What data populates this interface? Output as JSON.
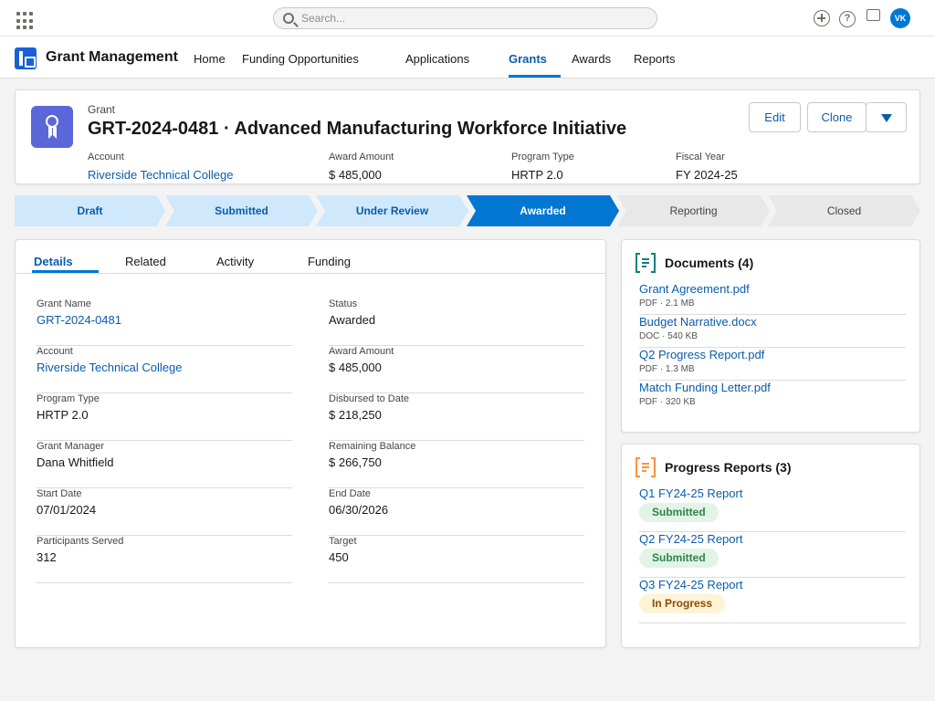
{
  "header": {
    "search_placeholder": "Search...",
    "avatar_initials": "VK"
  },
  "nav": {
    "app_name": "Grant Management",
    "items": [
      {
        "label": "Home"
      },
      {
        "label": "Funding Opportunities"
      },
      {
        "label": "Applications"
      },
      {
        "label": "Grants",
        "active": true
      },
      {
        "label": "Awards"
      },
      {
        "label": "Reports"
      }
    ]
  },
  "record": {
    "object_label": "Grant",
    "title": "GRT-2024-0481 · Advanced Manufacturing Workforce Initiative",
    "buttons": {
      "edit": "Edit",
      "clone": "Clone"
    },
    "highlights": [
      {
        "label": "Account",
        "value": "Riverside Technical College",
        "link": true
      },
      {
        "label": "Award Amount",
        "value": "$ 485,000"
      },
      {
        "label": "Program Type",
        "value": "HRTP 2.0"
      },
      {
        "label": "Fiscal Year",
        "value": "FY 2024-25"
      }
    ]
  },
  "path": {
    "stages": [
      {
        "label": "Draft",
        "state": "done"
      },
      {
        "label": "Submitted",
        "state": "done"
      },
      {
        "label": "Under Review",
        "state": "done"
      },
      {
        "label": "Awarded",
        "state": "current"
      },
      {
        "label": "Reporting",
        "state": "todo"
      },
      {
        "label": "Closed",
        "state": "todo"
      }
    ]
  },
  "details": {
    "tabs": [
      {
        "label": "Details",
        "active": true
      },
      {
        "label": "Related"
      },
      {
        "label": "Activity"
      },
      {
        "label": "Funding"
      }
    ],
    "fields": [
      {
        "label": "Grant Name",
        "value": "GRT-2024-0481",
        "link": true
      },
      {
        "label": "Status",
        "value": "Awarded"
      },
      {
        "label": "Account",
        "value": "Riverside Technical College",
        "link": true
      },
      {
        "label": "Award Amount",
        "value": "$ 485,000"
      },
      {
        "label": "Program Type",
        "value": "HRTP 2.0"
      },
      {
        "label": "Disbursed to Date",
        "value": "$ 218,250"
      },
      {
        "label": "Grant Manager",
        "value": "Dana Whitfield"
      },
      {
        "label": "Remaining Balance",
        "value": "$ 266,750"
      },
      {
        "label": "Start Date",
        "value": "07/01/2024"
      },
      {
        "label": "End Date",
        "value": "06/30/2026"
      },
      {
        "label": "Participants Served",
        "value": "312"
      },
      {
        "label": "Target",
        "value": "450"
      }
    ]
  },
  "documents": {
    "title": "Documents (4)",
    "icon_color": "#0b827c",
    "items": [
      {
        "name": "Grant Agreement.pdf",
        "meta": "PDF · 2.1 MB"
      },
      {
        "name": "Budget Narrative.docx",
        "meta": "DOC · 540 KB"
      },
      {
        "name": "Q2 Progress Report.pdf",
        "meta": "PDF · 1.3 MB"
      },
      {
        "name": "Match Funding Letter.pdf",
        "meta": "PDF · 320 KB"
      }
    ]
  },
  "progress_reports": {
    "title": "Progress Reports (3)",
    "icon_color": "#fe9339",
    "items": [
      {
        "name": "Q1 FY24-25 Report",
        "status": "Submitted",
        "tone": "green"
      },
      {
        "name": "Q2 FY24-25 Report",
        "status": "Submitted",
        "tone": "green"
      },
      {
        "name": "Q3 FY24-25 Report",
        "status": "In Progress",
        "tone": "yellow"
      }
    ]
  }
}
